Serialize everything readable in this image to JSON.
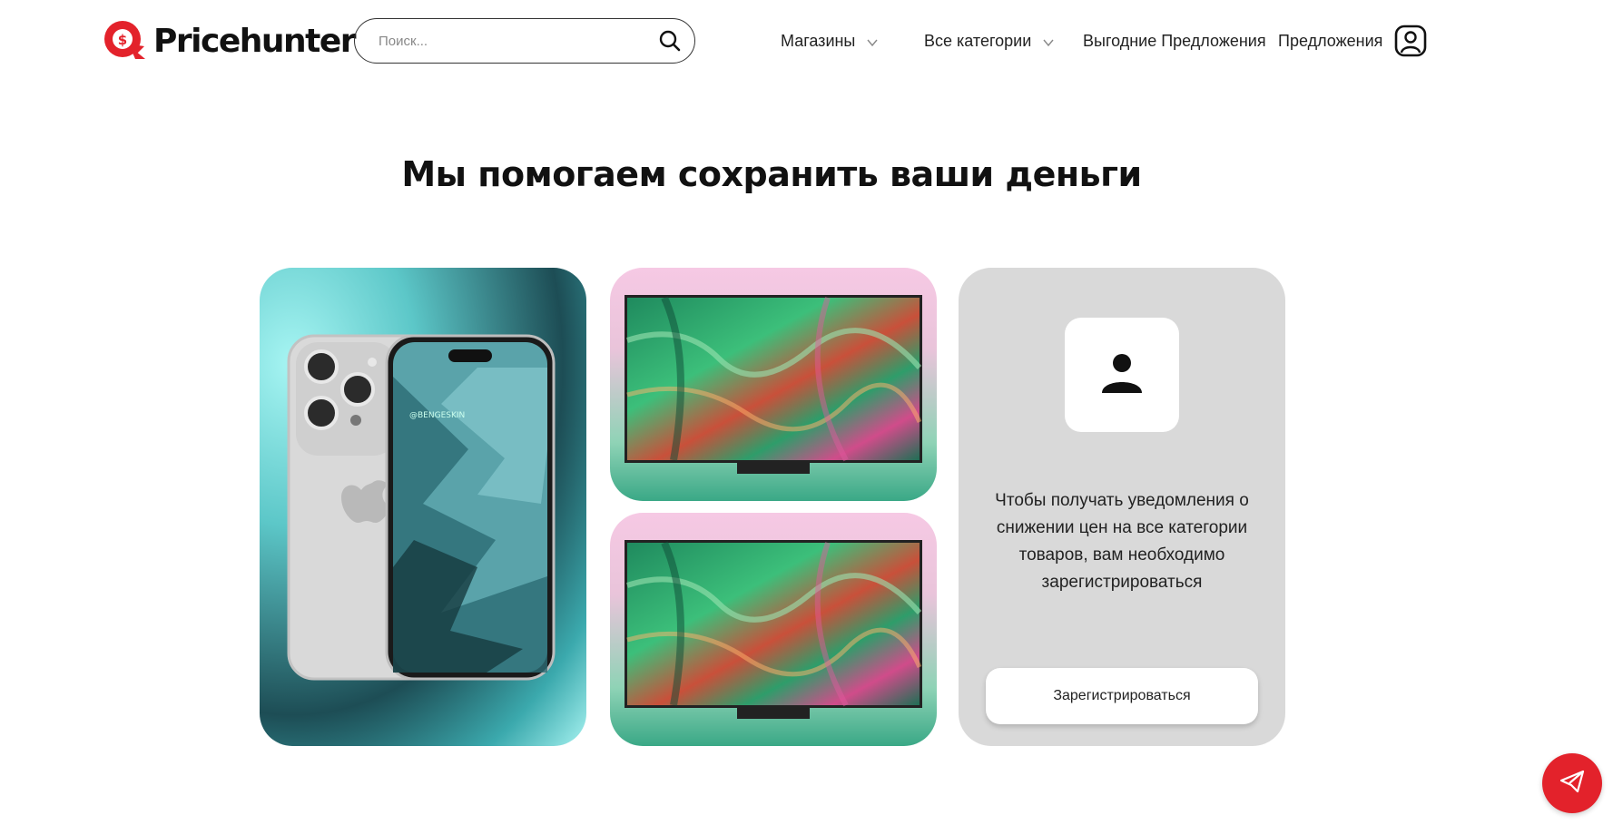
{
  "header": {
    "logo_text": "Pricehunter",
    "search_placeholder": "Поиск...",
    "nav": {
      "stores": "Магазины",
      "categories": "Все категории",
      "deals": "Выгодние Предложения",
      "offers": "Предложения"
    }
  },
  "hero": {
    "title": "Мы помогаем сохранить ваши деньги"
  },
  "cards": {
    "phone_watermark": "@BENGESKIN",
    "register": {
      "text": "Чтобы получать уведомления о снижении цен на все категории товаров, вам необходимо зарегистрироваться",
      "button_label": "Зарегистрироваться"
    }
  },
  "colors": {
    "brand": "#e3222b",
    "card_gray": "#d9d9d9"
  },
  "icons": [
    "logo-icon",
    "search-icon",
    "chevron-down-icon",
    "profile-icon",
    "user-icon",
    "telegram-icon"
  ]
}
